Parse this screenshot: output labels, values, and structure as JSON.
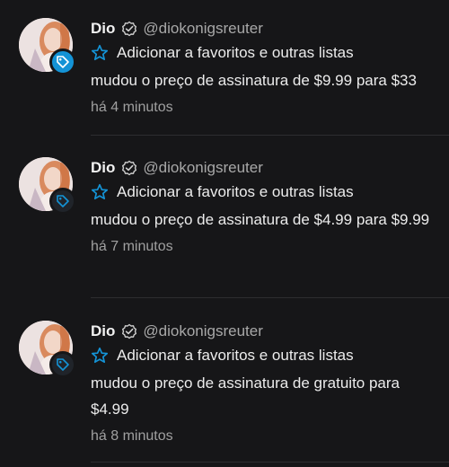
{
  "notifications": [
    {
      "name": "Dio",
      "handle": "@diokonigsreuter",
      "favorite_label": "Adicionar a favoritos e outras listas",
      "message": "mudou o preço de assinatura de $9.99 para $33",
      "time": "há 4 minutos",
      "badge_icon": "price-tag-icon",
      "badge_color": "#1493d6"
    },
    {
      "name": "Dio",
      "handle": "@diokonigsreuter",
      "favorite_label": "Adicionar a favoritos e outras listas",
      "message": "mudou o preço de assinatura de $4.99 para $9.99",
      "time": "há 7 minutos",
      "badge_icon": "price-tag-icon",
      "badge_color": "#20242a"
    },
    {
      "name": "Dio",
      "handle": "@diokonigsreuter",
      "favorite_label": "Adicionar a favoritos e outras listas",
      "message": "mudou o preço de assinatura de gratuito para $4.99",
      "time": "há 8 minutos",
      "badge_icon": "price-tag-icon",
      "badge_color": "#20242a"
    }
  ],
  "colors": {
    "background": "#161618",
    "accent": "#1493d6",
    "text": "#ececec",
    "muted": "#a0a0a0"
  }
}
